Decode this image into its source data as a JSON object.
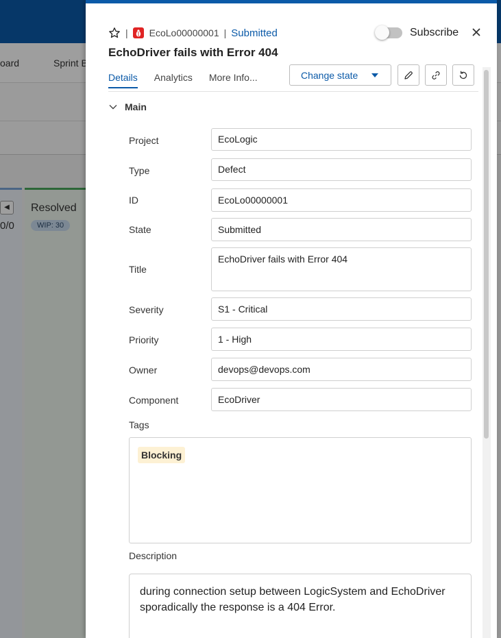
{
  "background": {
    "nav_items": [
      "oard",
      "Sprint B"
    ],
    "column_count": "0/0",
    "column_name": "Resolved",
    "column_wip": "WIP: 30"
  },
  "panel": {
    "item_id": "EcoLo00000001",
    "item_state": "Submitted",
    "subscribe_label": "Subscribe",
    "title": "EchoDriver fails with Error 404",
    "tabs": [
      {
        "label": "Details",
        "active": true
      },
      {
        "label": "Analytics",
        "active": false
      },
      {
        "label": "More Info...",
        "active": false
      }
    ],
    "change_state_label": "Change state",
    "section_label": "Main",
    "fields": {
      "project": {
        "label": "Project",
        "value": "EcoLogic"
      },
      "type": {
        "label": "Type",
        "value": "Defect"
      },
      "id": {
        "label": "ID",
        "value": "EcoLo00000001"
      },
      "state": {
        "label": "State",
        "value": "Submitted"
      },
      "title": {
        "label": "Title",
        "value": "EchoDriver fails with Error 404"
      },
      "severity": {
        "label": "Severity",
        "value": "S1 - Critical"
      },
      "priority": {
        "label": "Priority",
        "value": "1 - High"
      },
      "owner": {
        "label": "Owner",
        "value": "devops@devops.com"
      },
      "component": {
        "label": "Component",
        "value": "EcoDriver"
      }
    },
    "tags_label": "Tags",
    "tags": [
      "Blocking"
    ],
    "description_label": "Description",
    "description": "during connection setup between LogicSystem and EchoDriver sporadically the response is a 404 Error."
  },
  "colors": {
    "accent": "#0b5aa8",
    "defect_badge": "#e02424",
    "tag_bg": "#fdf1d4",
    "resolved_column": "#49a55b"
  },
  "icons": [
    "star-icon",
    "defect-icon",
    "close-icon",
    "chevron-down-icon",
    "caret-down-icon",
    "pencil-icon",
    "link-icon",
    "refresh-icon"
  ]
}
